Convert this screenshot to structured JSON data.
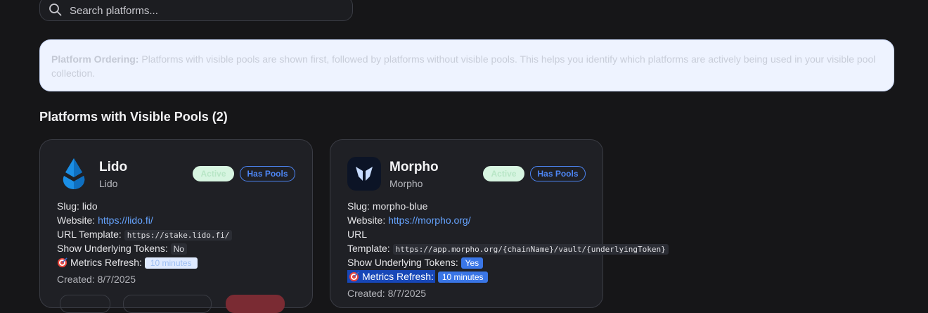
{
  "search": {
    "placeholder": "Search platforms..."
  },
  "notice": {
    "label": "Platform Ordering:",
    "text": "Platforms with visible pools are shown first, followed by platforms without visible pools. This helps you identify which platforms are actively being used in your visible pool collection."
  },
  "section": {
    "title": "Platforms with Visible Pools (2)"
  },
  "cards": [
    {
      "name": "Lido",
      "subtitle": "Lido",
      "status": "Active",
      "pools_badge": "Has Pools",
      "slug_label": "Slug:",
      "slug": "lido",
      "website_label": "Website:",
      "website": "https://lido.fi/",
      "template_label": "URL Template:",
      "template": "https://stake.lido.fi/",
      "tokens_label": "Show Underlying Tokens:",
      "tokens": "No",
      "refresh_label": "Metrics Refresh:",
      "refresh": "10 minutes",
      "created": "Created: 8/7/2025"
    },
    {
      "name": "Morpho",
      "subtitle": "Morpho",
      "status": "Active",
      "pools_badge": "Has Pools",
      "slug_label": "Slug:",
      "slug": "morpho-blue",
      "website_label": "Website:",
      "website": "https://morpho.org/",
      "url_label": "URL",
      "template_label": "Template:",
      "template": "https://app.morpho.org/{chainName}/vault/{underlyingToken}",
      "tokens_label": "Show Underlying Tokens:",
      "tokens": "Yes",
      "refresh_label": "Metrics Refresh:",
      "refresh": "10 minutes",
      "created": "Created: 8/7/2025"
    }
  ],
  "icons": {
    "search": "search-icon",
    "lido_logo": "lido-logo-icon",
    "morpho_logo": "morpho-logo-icon",
    "target": "target-icon"
  },
  "colors": {
    "background": "#161618",
    "card": "#1f2025",
    "link": "#66a4ff",
    "badge_blue": "#4d86f5",
    "notice_bg": "#eef3ff"
  }
}
